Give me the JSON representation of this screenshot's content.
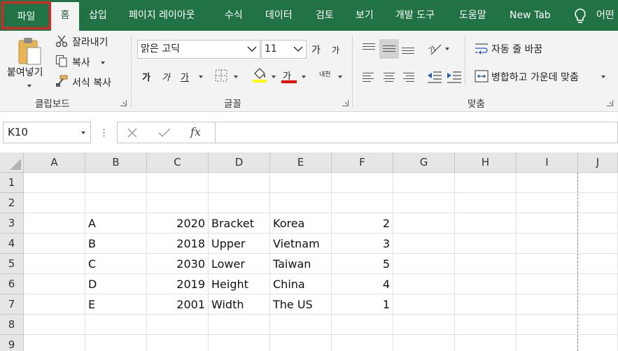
{
  "tabs": [
    "파일",
    "홈",
    "삽입",
    "페이지 레이아웃",
    "수식",
    "데이터",
    "검토",
    "보기",
    "개발 도구",
    "도움말",
    "New Tab",
    "어떤"
  ],
  "clipboard": {
    "paste_label": "붙여넣기",
    "cut_label": "잘라내기",
    "copy_label": "복사",
    "format_painter_label": "서식 복사",
    "group_label": "클립보드"
  },
  "font": {
    "name": "맑은 고딕",
    "size": "11",
    "grow_glyph": "가",
    "shrink_glyph": "가",
    "bold_glyph": "가",
    "italic_glyph": "가",
    "underline_glyph": "가",
    "font_color_glyph": "가",
    "phonetic_glyph": "내천",
    "fill_color": "#ffff00",
    "font_color": "#ff0000",
    "group_label": "글꼴"
  },
  "alignment": {
    "wrap_text_label": "자동 줄 바꿈",
    "merge_center_label": "병합하고 가운데 맞춤",
    "group_label": "맞춤"
  },
  "formula_bar": {
    "name_box": "K10",
    "fx_label": "fx",
    "formula": ""
  },
  "grid": {
    "columns": [
      "A",
      "B",
      "C",
      "D",
      "E",
      "F",
      "G",
      "H",
      "I",
      "J"
    ],
    "rows": [
      "1",
      "2",
      "3",
      "4",
      "5",
      "6",
      "7",
      "8",
      "9"
    ],
    "cells": [
      [
        "",
        "",
        "",
        "",
        "",
        "",
        "",
        "",
        "",
        ""
      ],
      [
        "",
        "",
        "",
        "",
        "",
        "",
        "",
        "",
        "",
        ""
      ],
      [
        "",
        "A",
        "2020",
        "Bracket",
        "Korea",
        "2",
        "",
        "",
        "",
        ""
      ],
      [
        "",
        "B",
        "2018",
        "Upper",
        "Vietnam",
        "3",
        "",
        "",
        "",
        ""
      ],
      [
        "",
        "C",
        "2030",
        "Lower",
        "Taiwan",
        "5",
        "",
        "",
        "",
        ""
      ],
      [
        "",
        "D",
        "2019",
        "Height",
        "China",
        "4",
        "",
        "",
        "",
        ""
      ],
      [
        "",
        "E",
        "2001",
        "Width",
        "The US",
        "1",
        "",
        "",
        "",
        ""
      ],
      [
        "",
        "",
        "",
        "",
        "",
        "",
        "",
        "",
        "",
        ""
      ],
      [
        "",
        "",
        "",
        "",
        "",
        "",
        "",
        "",
        "",
        ""
      ]
    ]
  },
  "colors": {
    "accent": "#217346",
    "highlight_border": "#e0211f"
  }
}
